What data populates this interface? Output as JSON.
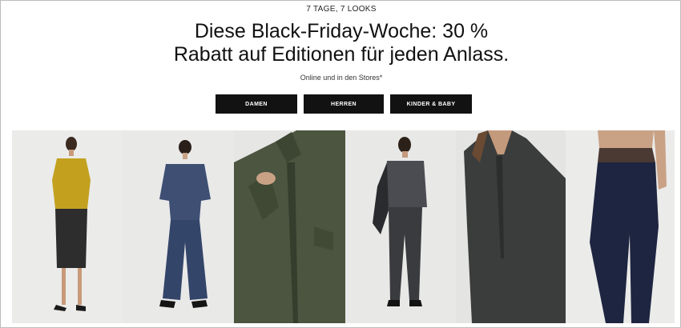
{
  "header": {
    "eyebrow": "7 TAGE, 7 LOOKS",
    "headline_line1": "Diese Black-Friday-Woche: 30 %",
    "headline_line2": "Rabatt auf Editionen für jeden Anlass.",
    "subline": "Online und in den Stores*"
  },
  "categories": [
    {
      "label": "DAMEN"
    },
    {
      "label": "HERREN"
    },
    {
      "label": "KINDER & BABY"
    }
  ],
  "gallery": {
    "tiles": [
      {
        "name": "look-yellow-shirt-black-skirt",
        "bg": "#ebebea",
        "accent": "#c3a11f"
      },
      {
        "name": "look-navy-top-wide-trousers",
        "bg": "#e9e9e8",
        "accent": "#3e4f73"
      },
      {
        "name": "look-olive-jacket-closeup",
        "bg": "#e6e6e4",
        "accent": "#46503b"
      },
      {
        "name": "look-grey-shirt-men",
        "bg": "#e8e8e7",
        "accent": "#4a4c52"
      },
      {
        "name": "look-dark-grey-dress-closeup",
        "bg": "#e4e4e2",
        "accent": "#3b3d3c"
      },
      {
        "name": "look-navy-leggings",
        "bg": "#ebebea",
        "accent": "#1d2540"
      }
    ]
  }
}
